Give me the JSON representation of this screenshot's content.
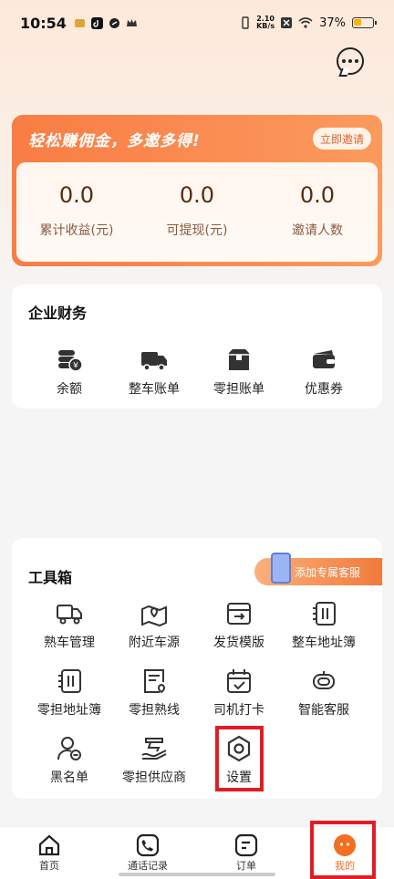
{
  "status_bar": {
    "time": "10:54",
    "net_speed_value": "2.10",
    "net_speed_unit": "KB/s",
    "battery": "37%"
  },
  "invite": {
    "title": "轻松赚佣金，多邀多得!",
    "button": "立即邀请",
    "stats": [
      {
        "value": "0.0",
        "label": "累计收益(元)"
      },
      {
        "value": "0.0",
        "label": "可提现(元)"
      },
      {
        "value": "0.0",
        "label": "邀请人数"
      }
    ]
  },
  "finance": {
    "title": "企业财务",
    "items": [
      {
        "label": "余额",
        "icon": "coins-icon"
      },
      {
        "label": "整车账单",
        "icon": "truck-icon"
      },
      {
        "label": "零担账单",
        "icon": "box-icon"
      },
      {
        "label": "优惠券",
        "icon": "coupon-icon"
      }
    ]
  },
  "toolbox": {
    "title": "工具箱",
    "service_banner": "添加专属客服",
    "items": [
      {
        "label": "熟车管理",
        "icon": "truck-outline-icon"
      },
      {
        "label": "附近车源",
        "icon": "map-pin-icon"
      },
      {
        "label": "发货模版",
        "icon": "template-icon"
      },
      {
        "label": "整车地址簿",
        "icon": "address-book-icon"
      },
      {
        "label": "零担地址簿",
        "icon": "address-book-icon"
      },
      {
        "label": "零担熟线",
        "icon": "route-doc-icon"
      },
      {
        "label": "司机打卡",
        "icon": "calendar-check-icon"
      },
      {
        "label": "智能客服",
        "icon": "robot-icon"
      },
      {
        "label": "黑名单",
        "icon": "user-minus-icon"
      },
      {
        "label": "零担供应商",
        "icon": "supplier-icon"
      },
      {
        "label": "设置",
        "icon": "settings-hex-icon"
      }
    ]
  },
  "bottom_nav": [
    {
      "label": "首页",
      "icon": "home-icon"
    },
    {
      "label": "通话记录",
      "icon": "phone-icon"
    },
    {
      "label": "订单",
      "icon": "order-icon"
    },
    {
      "label": "我的",
      "icon": "profile-face-icon",
      "active": true
    }
  ],
  "colors": {
    "accent": "#f36e1f",
    "highlight": "#e21c25"
  }
}
